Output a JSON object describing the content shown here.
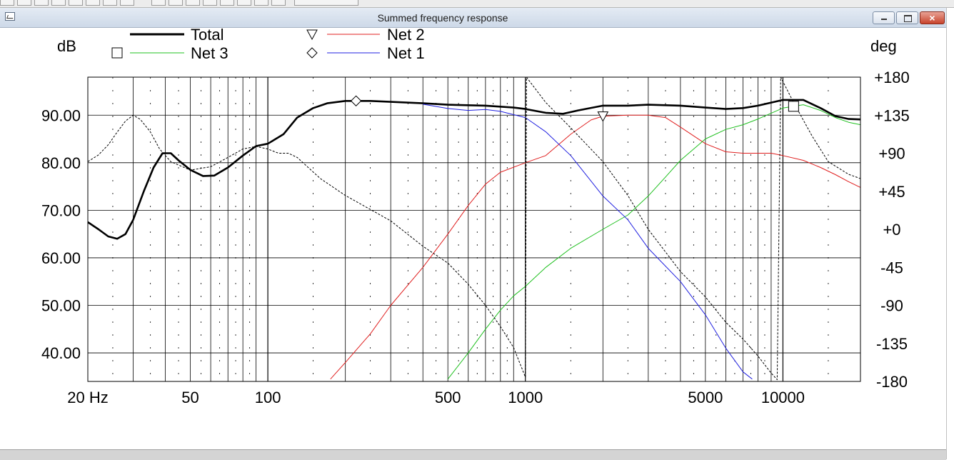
{
  "window": {
    "title": "Summed frequency response",
    "buttons": [
      "minimize",
      "maximize",
      "close"
    ],
    "close_glyph": "×"
  },
  "chart_data": {
    "type": "line",
    "left_axis_label": "dB",
    "right_axis_label": "deg",
    "x_scale": "log",
    "xlim": [
      20,
      20000
    ],
    "x_tick_labels": [
      {
        "value": 20,
        "label": "20 Hz"
      },
      {
        "value": 50,
        "label": "50"
      },
      {
        "value": 100,
        "label": "100"
      },
      {
        "value": 500,
        "label": "500"
      },
      {
        "value": 1000,
        "label": "1000"
      },
      {
        "value": 5000,
        "label": "5000"
      },
      {
        "value": 10000,
        "label": "10000"
      }
    ],
    "ylim_left": [
      34,
      98
    ],
    "y_left_ticks": [
      40,
      50,
      60,
      70,
      80,
      90
    ],
    "y_left_tick_labels": [
      "40.00",
      "50.00",
      "60.00",
      "70.00",
      "80.00",
      "90.00"
    ],
    "ylim_right": [
      -180,
      180
    ],
    "y_right_ticks": [
      -180,
      -135,
      -90,
      -45,
      0,
      45,
      90,
      135,
      180
    ],
    "y_right_tick_labels": [
      "-180",
      "-135",
      "-90",
      "-45",
      "+0",
      "+45",
      "+90",
      "+135",
      "+180"
    ],
    "grid": true,
    "legend": [
      {
        "name": "Total",
        "color": "#000000",
        "marker": "",
        "width": 3
      },
      {
        "name": "Net 2",
        "color": "#e02020",
        "marker": "triangle-down",
        "width": 1
      },
      {
        "name": "Net 3",
        "color": "#20c020",
        "marker": "square",
        "width": 1
      },
      {
        "name": "Net 1",
        "color": "#2020e0",
        "marker": "diamond",
        "width": 1
      }
    ],
    "series": [
      {
        "name": "Total",
        "axis": "left",
        "color": "#000000",
        "marker": "",
        "marker_at": null,
        "points": [
          [
            20,
            67.5
          ],
          [
            22,
            66
          ],
          [
            24,
            64.5
          ],
          [
            26,
            64
          ],
          [
            28,
            65
          ],
          [
            30,
            68
          ],
          [
            33,
            74
          ],
          [
            36,
            79
          ],
          [
            39,
            82
          ],
          [
            42,
            82
          ],
          [
            45,
            80.5
          ],
          [
            50,
            78.5
          ],
          [
            56,
            77.2
          ],
          [
            62,
            77.3
          ],
          [
            70,
            79
          ],
          [
            80,
            81.5
          ],
          [
            90,
            83.5
          ],
          [
            100,
            84
          ],
          [
            115,
            86
          ],
          [
            130,
            89.5
          ],
          [
            150,
            91.5
          ],
          [
            170,
            92.5
          ],
          [
            200,
            93
          ],
          [
            250,
            93
          ],
          [
            300,
            92.8
          ],
          [
            400,
            92.5
          ],
          [
            500,
            92.2
          ],
          [
            700,
            92
          ],
          [
            900,
            91.6
          ],
          [
            1000,
            91.3
          ],
          [
            1200,
            90.5
          ],
          [
            1400,
            90.3
          ],
          [
            1600,
            91
          ],
          [
            2000,
            92
          ],
          [
            2500,
            92
          ],
          [
            3000,
            92.2
          ],
          [
            4000,
            92
          ],
          [
            5000,
            91.6
          ],
          [
            6000,
            91.3
          ],
          [
            7000,
            91.5
          ],
          [
            8000,
            92
          ],
          [
            10000,
            93.2
          ],
          [
            12000,
            93.2
          ],
          [
            14000,
            91.5
          ],
          [
            16000,
            89.8
          ],
          [
            18000,
            89.2
          ],
          [
            20000,
            89.1
          ]
        ]
      },
      {
        "name": "Net 2",
        "axis": "left",
        "color": "#e02020",
        "marker": "triangle-down",
        "marker_at": 2000,
        "points": [
          [
            175,
            34.5
          ],
          [
            200,
            38
          ],
          [
            250,
            44
          ],
          [
            300,
            50
          ],
          [
            400,
            58
          ],
          [
            500,
            65
          ],
          [
            600,
            71
          ],
          [
            700,
            75.5
          ],
          [
            800,
            78
          ],
          [
            1000,
            80
          ],
          [
            1200,
            81.5
          ],
          [
            1500,
            86
          ],
          [
            1800,
            89
          ],
          [
            2000,
            89.8
          ],
          [
            2500,
            90
          ],
          [
            3000,
            90
          ],
          [
            3500,
            89.5
          ],
          [
            4000,
            87.5
          ],
          [
            5000,
            84
          ],
          [
            6000,
            82.3
          ],
          [
            7000,
            82
          ],
          [
            8000,
            82
          ],
          [
            9000,
            82
          ],
          [
            10000,
            81.5
          ],
          [
            12000,
            80.5
          ],
          [
            14000,
            79
          ],
          [
            16000,
            77.5
          ],
          [
            18000,
            76
          ],
          [
            20000,
            74.8
          ]
        ]
      },
      {
        "name": "Net 3",
        "axis": "left",
        "color": "#20c020",
        "marker": "square",
        "marker_at": 11000,
        "points": [
          [
            500,
            34.5
          ],
          [
            600,
            40
          ],
          [
            700,
            45
          ],
          [
            800,
            49
          ],
          [
            900,
            52
          ],
          [
            1000,
            54
          ],
          [
            1200,
            58
          ],
          [
            1500,
            62
          ],
          [
            2000,
            66
          ],
          [
            2500,
            69
          ],
          [
            3000,
            73
          ],
          [
            3500,
            77
          ],
          [
            4000,
            80.5
          ],
          [
            5000,
            85
          ],
          [
            6000,
            87
          ],
          [
            7000,
            88
          ],
          [
            8000,
            89.2
          ],
          [
            10000,
            91.5
          ],
          [
            12000,
            92.2
          ],
          [
            14000,
            91
          ],
          [
            16000,
            89.5
          ],
          [
            18000,
            88.5
          ],
          [
            20000,
            88
          ]
        ]
      },
      {
        "name": "Net 1",
        "axis": "left",
        "color": "#2020e0",
        "marker": "diamond",
        "marker_at": 220,
        "points": [
          [
            400,
            92.3
          ],
          [
            500,
            91.4
          ],
          [
            600,
            91
          ],
          [
            700,
            91.2
          ],
          [
            800,
            90.8
          ],
          [
            1000,
            89.5
          ],
          [
            1200,
            86.5
          ],
          [
            1500,
            81.5
          ],
          [
            2000,
            73
          ],
          [
            2500,
            68
          ],
          [
            3000,
            62
          ],
          [
            4000,
            55
          ],
          [
            5000,
            48
          ],
          [
            6000,
            41
          ],
          [
            7000,
            36
          ],
          [
            7600,
            34.5
          ]
        ]
      },
      {
        "name": "Total phase",
        "axis": "right",
        "color": "#000000",
        "dashed": true,
        "marker": "",
        "points": [
          [
            20,
            80
          ],
          [
            22,
            88
          ],
          [
            24,
            100
          ],
          [
            26,
            115
          ],
          [
            28,
            128
          ],
          [
            30,
            135
          ],
          [
            32,
            130
          ],
          [
            35,
            115
          ],
          [
            38,
            95
          ],
          [
            42,
            80
          ],
          [
            50,
            70
          ],
          [
            60,
            74
          ],
          [
            70,
            85
          ],
          [
            80,
            95
          ],
          [
            90,
            98
          ],
          [
            100,
            95
          ],
          [
            110,
            90
          ],
          [
            120,
            90
          ],
          [
            130,
            85
          ],
          [
            160,
            60
          ],
          [
            200,
            40
          ],
          [
            300,
            10
          ],
          [
            400,
            -20
          ],
          [
            500,
            -40
          ],
          [
            600,
            -65
          ],
          [
            700,
            -90
          ],
          [
            800,
            -115
          ],
          [
            900,
            -140
          ],
          [
            1000,
            -175
          ],
          [
            1010,
            180
          ],
          [
            1200,
            150
          ],
          [
            1500,
            120
          ],
          [
            2000,
            80
          ],
          [
            2500,
            40
          ],
          [
            3000,
            0
          ],
          [
            4000,
            -50
          ],
          [
            5000,
            -80
          ],
          [
            6000,
            -110
          ],
          [
            7000,
            -130
          ],
          [
            8000,
            -150
          ],
          [
            9000,
            -170
          ],
          [
            9500,
            -178
          ],
          [
            9800,
            180
          ],
          [
            11000,
            150
          ],
          [
            13000,
            110
          ],
          [
            15000,
            80
          ],
          [
            18000,
            65
          ],
          [
            20000,
            60
          ]
        ]
      }
    ]
  }
}
